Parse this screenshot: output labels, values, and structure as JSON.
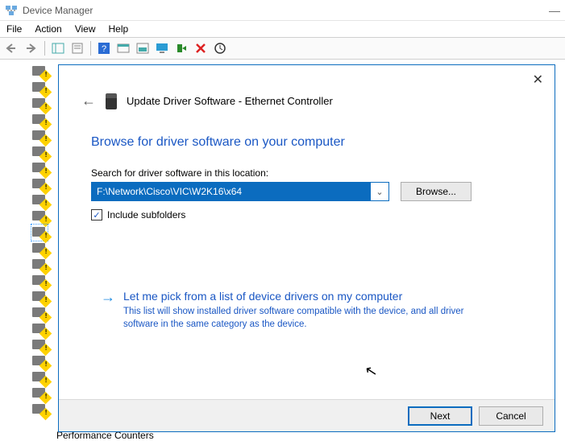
{
  "window": {
    "title": "Device Manager"
  },
  "menu": {
    "file": "File",
    "action": "Action",
    "view": "View",
    "help": "Help"
  },
  "tree": {
    "bottom_label": "Performance Counters"
  },
  "dialog": {
    "header": "Update Driver Software - Ethernet Controller",
    "heading": "Browse for driver software on your computer",
    "search_label": "Search for driver software in this location:",
    "path_value": "F:\\Network\\Cisco\\VIC\\W2K16\\x64",
    "browse_label": "Browse...",
    "include_subfolders": "Include subfolders",
    "pick_title": "Let me pick from a list of device drivers on my computer",
    "pick_desc": "This list will show installed driver software compatible with the device, and all driver software in the same category as the device.",
    "next_label": "Next",
    "cancel_label": "Cancel"
  }
}
